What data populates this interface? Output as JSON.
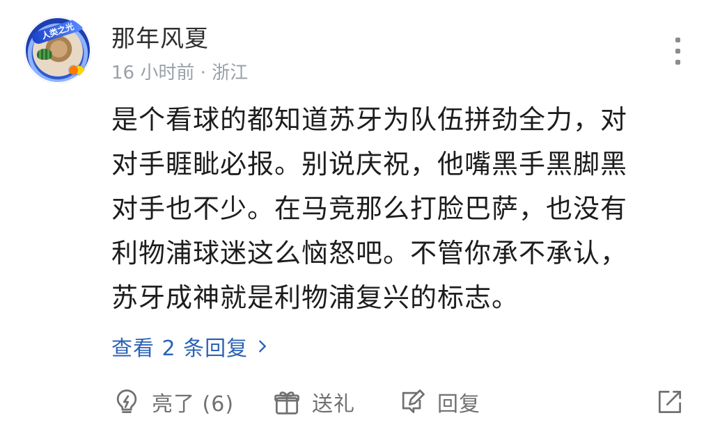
{
  "comment": {
    "username": "那年风夏",
    "meta": "16 小时前 · 浙江",
    "avatar": {
      "ribbon_text": "人类之光"
    },
    "content_lines": [
      "是个看球的都知道苏牙为队伍拼劲全力，对",
      "对手睚眦必报。别说庆祝，他嘴黑手黑脚黑",
      "对手也不少。在马竞那么打脸巴萨，也没有",
      "利物浦球迷这么恼怒吧。不管你承不承认，",
      "苏牙成神就是利物浦复兴的标志。"
    ],
    "view_replies_label": "查看 2 条回复"
  },
  "actions": {
    "like_label": "亮了 (6)",
    "gift_label": "送礼",
    "reply_label": "回复"
  },
  "icons": {
    "more": "more-vertical-icon",
    "like": "lightbulb-icon",
    "gift": "gift-icon",
    "reply": "edit-reply-icon",
    "share": "share-icon",
    "chevron": "chevron-right-icon"
  },
  "colors": {
    "link_blue": "#2b63b5",
    "action_gray": "#707070",
    "meta_gray": "#9aa0a6"
  }
}
